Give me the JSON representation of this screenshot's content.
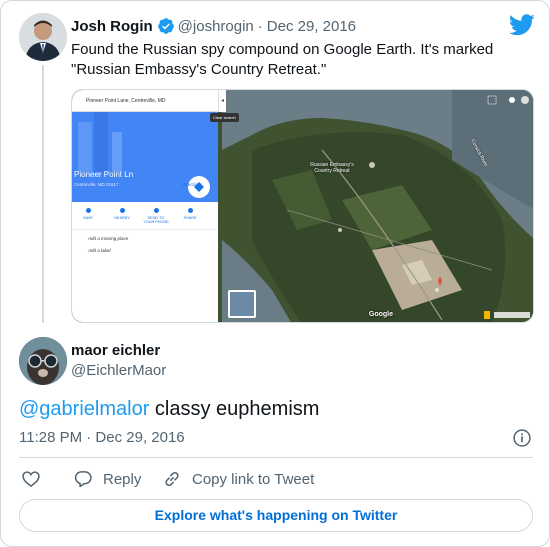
{
  "quoted_tweet": {
    "author_name": "Josh Rogin",
    "handle": "@joshrogin",
    "separator": "·",
    "date": "Dec 29, 2016",
    "text": "Found the Russian spy compound on Google Earth. It's marked \"Russian Embassy's Country Retreat.\"",
    "verified_icon": "verified-badge-icon",
    "brand_icon": "twitter-bird-icon",
    "media": {
      "search_text": "Pioneer Point Lane, Centreville, MD",
      "clear_search": "Clear search",
      "place_title": "Pioneer Point Ln",
      "place_address": "Centreville, MD 21617",
      "directions_label": "Directions",
      "actions": [
        "SAVE",
        "NEARBY",
        "SEND TO YOUR PHONE",
        "SHARE"
      ],
      "add_missing_place": "Add a missing place",
      "add_label": "Add a label",
      "map_label": "Russian Embassy's Country Retreat",
      "river_label": "Corsica River",
      "google_mark": "Google"
    }
  },
  "reply_tweet": {
    "author_name": "maor eichler",
    "handle": "@EichlerMaor",
    "mention": "@gabrielmalor",
    "text_rest": " classy euphemism",
    "timestamp": "11:28 PM · Dec 29, 2016"
  },
  "actions": {
    "like_label": "",
    "reply_label": "Reply",
    "copy_link_label": "Copy link to Tweet"
  },
  "explore_button": "Explore what's happening on Twitter",
  "colors": {
    "accent": "#1d9bf0",
    "explore_text": "#006fd6",
    "muted": "#536471",
    "border": "#cfd9de"
  }
}
